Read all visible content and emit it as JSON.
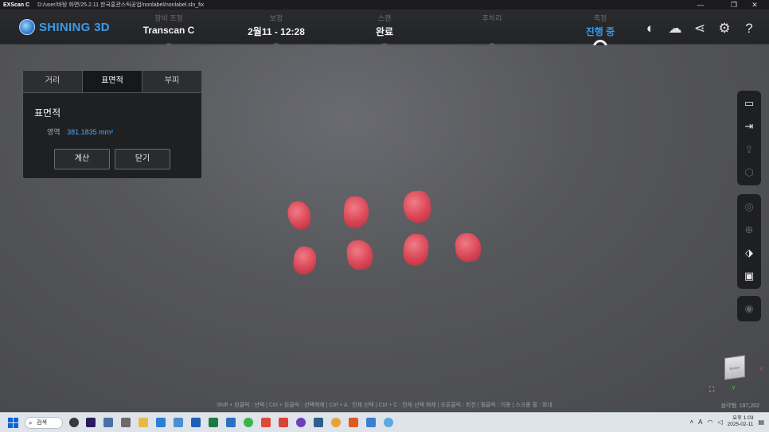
{
  "titlebar": {
    "app": "EXScan C",
    "path": "D:/user/바탕 화면/25.2.11 한국홍관스틱공업/nonlabel/nonlabel.sln_fix",
    "min": "—",
    "restore": "❐",
    "close": "✕"
  },
  "brand": {
    "name": "SHINING 3D"
  },
  "steps": [
    {
      "label": "장비 조정",
      "value": "Transcan C"
    },
    {
      "label": "보정",
      "value": "2월11 - 12:28"
    },
    {
      "label": "스캔",
      "value": "완료"
    },
    {
      "label": "후처리",
      "value": ""
    },
    {
      "label": "측정",
      "value": "진행 중"
    }
  ],
  "header_icons": {
    "account": "◐",
    "cloud": "☁",
    "share": "⋖",
    "settings": "⚙",
    "help": "?"
  },
  "panel": {
    "tabs": [
      "거리",
      "표면적",
      "부피"
    ],
    "active_tab": 1,
    "title": "표면적",
    "area_label": "영역",
    "area_value": "381.1835",
    "area_unit": "mm²",
    "calc_button": "계산",
    "close_button": "닫기"
  },
  "right_toolbar": {
    "group1": [
      "folder-icon",
      "export-icon",
      "upload-icon",
      "cube-icon"
    ],
    "group2": [
      "camera-icon",
      "target-icon",
      "eraser-icon",
      "save-icon"
    ],
    "group3": [
      "eye-icon"
    ]
  },
  "view_cube": {
    "face": "Bottom",
    "x": "X",
    "y": "Y"
  },
  "hint": "Shift + 왼클릭 : 선택 | Ctrl + 왼클릭 : 선택해제 | Ctrl + A : 전체 선택 | Ctrl + C : 전체 선택 해제 | 오른클릭 : 회전 | 휠클릭 : 이동 | 스크롤 휠 : 확대",
  "triangle_count": "삼각형: 197,202",
  "taskbar": {
    "search": "검색",
    "time": "오후 1:03",
    "date": "2025-02-11",
    "lang": "A"
  },
  "colors": {
    "accent": "#2f9bf0",
    "tooth": "#d94656"
  }
}
